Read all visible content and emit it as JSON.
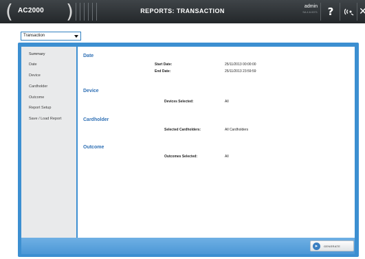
{
  "app": {
    "brand": "AC2000",
    "title": "REPORTS: TRANSACTION",
    "user": "admin",
    "version": "SA 4.6.0071"
  },
  "toolbar": {
    "help_icon": "question-icon",
    "connection_icon": "signal-icon",
    "close_icon": "close-icon"
  },
  "report_select": {
    "value": "Transaction"
  },
  "sidebar": {
    "items": [
      {
        "label": "Summary"
      },
      {
        "label": "Date"
      },
      {
        "label": "Device"
      },
      {
        "label": "Cardholder"
      },
      {
        "label": "Outcome"
      },
      {
        "label": "Report Setup"
      },
      {
        "label": "Save / Load Report"
      }
    ]
  },
  "summary": {
    "date": {
      "heading": "Date",
      "start_label": "Start Date:",
      "start_value": "25/11/2013 00:00:00",
      "end_label": "End Date:",
      "end_value": "25/11/2013 23:59:59"
    },
    "device": {
      "heading": "Device",
      "label": "Devices Selected:",
      "value": "All"
    },
    "cardholder": {
      "heading": "Cardholder",
      "label": "Selected Cardholders:",
      "value": "All Cardholders"
    },
    "outcome": {
      "heading": "Outcome",
      "label": "Outcomes Selected:",
      "value": "All"
    }
  },
  "footer": {
    "generate_label": "GENERATE"
  },
  "colors": {
    "accent": "#3c8fd1",
    "section_heading": "#2f70b5",
    "topbar": "#2d3134"
  }
}
